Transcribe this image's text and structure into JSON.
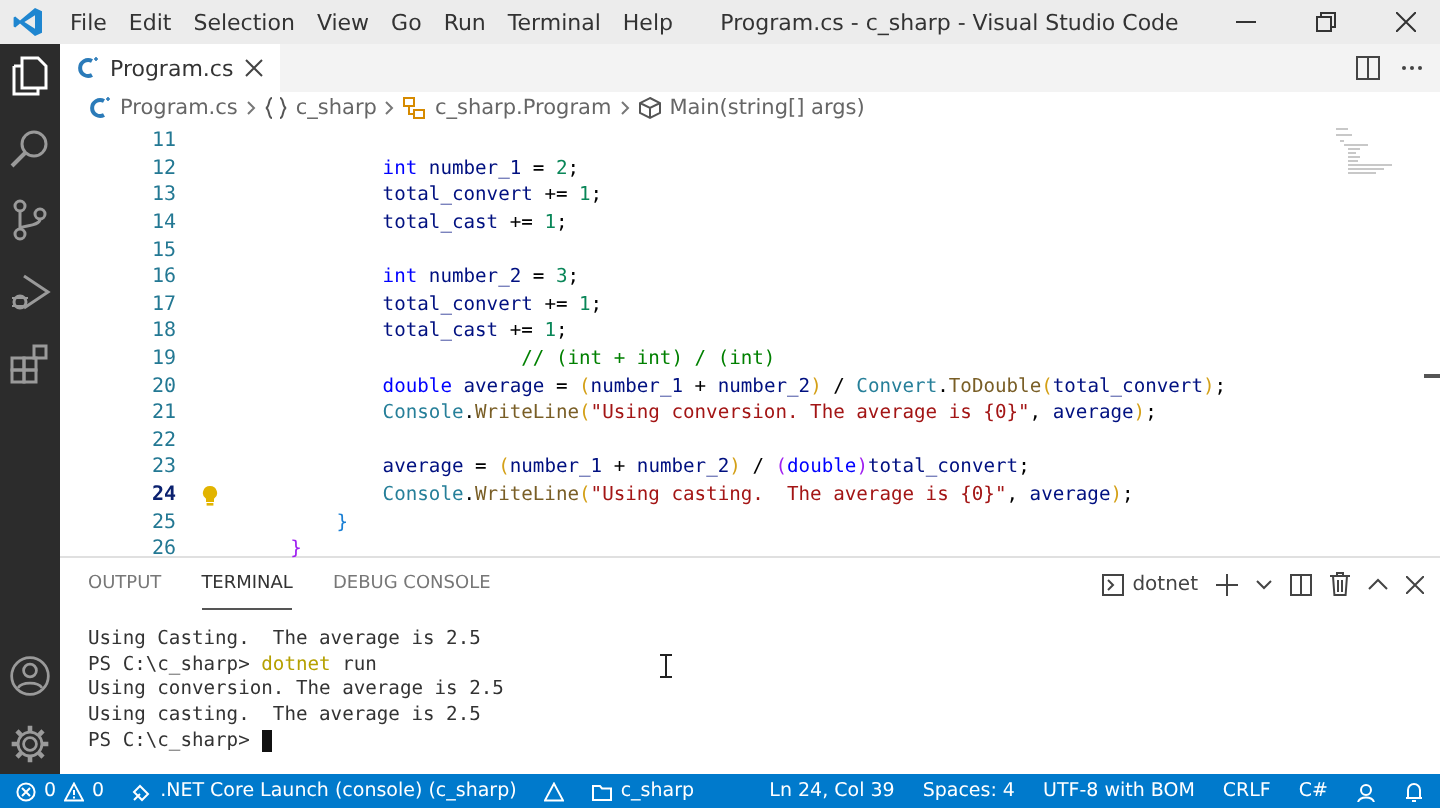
{
  "window": {
    "title": "Program.cs - c_sharp - Visual Studio Code"
  },
  "menu": [
    "File",
    "Edit",
    "Selection",
    "View",
    "Go",
    "Run",
    "Terminal",
    "Help"
  ],
  "activity_bar": [
    {
      "kind": "files",
      "selected": true
    },
    {
      "kind": "search",
      "selected": false
    },
    {
      "kind": "scm",
      "selected": false
    },
    {
      "kind": "debug",
      "selected": false
    },
    {
      "kind": "extensions",
      "selected": false
    }
  ],
  "editor_tabs": [
    {
      "label": "Program.cs",
      "selected": true
    }
  ],
  "breadcrumb": [
    {
      "kind": "file",
      "label": "Program.cs"
    },
    {
      "kind": "namespace",
      "label": "c_sharp"
    },
    {
      "kind": "class",
      "label": "c_sharp.Program"
    },
    {
      "kind": "method",
      "label": "Main(string[] args)"
    }
  ],
  "code": [
    {
      "number": "11",
      "current": false
    },
    {
      "number": "12",
      "current": false,
      "tokens": [
        {
          "kind": "keyword",
          "text": "            int"
        },
        {
          "kind": "variable",
          "text": " number_1 "
        },
        {
          "kind": "operator",
          "text": "= "
        },
        {
          "kind": "number",
          "text": "2"
        },
        {
          "kind": "operator",
          "text": ";"
        }
      ]
    },
    {
      "number": "13",
      "current": false,
      "tokens": [
        {
          "kind": "variable",
          "text": "            total_convert "
        },
        {
          "kind": "operator",
          "text": "+= "
        },
        {
          "kind": "number",
          "text": "1"
        },
        {
          "kind": "operator",
          "text": ";"
        }
      ]
    },
    {
      "number": "14",
      "current": false,
      "tokens": [
        {
          "kind": "variable",
          "text": "            total_cast "
        },
        {
          "kind": "operator",
          "text": "+= "
        },
        {
          "kind": "number",
          "text": "1"
        },
        {
          "kind": "operator",
          "text": ";"
        }
      ]
    },
    {
      "number": "15",
      "current": false
    },
    {
      "number": "16",
      "current": false,
      "tokens": [
        {
          "kind": "keyword",
          "text": "            int"
        },
        {
          "kind": "variable",
          "text": " number_2 "
        },
        {
          "kind": "operator",
          "text": "= "
        },
        {
          "kind": "number",
          "text": "3"
        },
        {
          "kind": "operator",
          "text": ";"
        }
      ]
    },
    {
      "number": "17",
      "current": false,
      "tokens": [
        {
          "kind": "variable",
          "text": "            total_convert "
        },
        {
          "kind": "operator",
          "text": "+= "
        },
        {
          "kind": "number",
          "text": "1"
        },
        {
          "kind": "operator",
          "text": ";"
        }
      ]
    },
    {
      "number": "18",
      "current": false,
      "tokens": [
        {
          "kind": "variable",
          "text": "            total_cast "
        },
        {
          "kind": "operator",
          "text": "+= "
        },
        {
          "kind": "number",
          "text": "1"
        },
        {
          "kind": "operator",
          "text": ";"
        }
      ]
    },
    {
      "number": "19",
      "current": false,
      "tokens": [
        {
          "kind": "comment",
          "text": "                        // (int + int) / (int)"
        }
      ]
    },
    {
      "number": "20",
      "current": false,
      "tokens": [
        {
          "kind": "keyword",
          "text": "            double"
        },
        {
          "kind": "variable",
          "text": " average "
        },
        {
          "kind": "operator",
          "text": "= "
        },
        {
          "kind": "bracket",
          "text": "("
        },
        {
          "kind": "variable",
          "text": "number_1 "
        },
        {
          "kind": "operator",
          "text": "+ "
        },
        {
          "kind": "variable",
          "text": "number_2"
        },
        {
          "kind": "bracket",
          "text": ")"
        },
        {
          "kind": "operator",
          "text": " / "
        },
        {
          "kind": "type",
          "text": "Convert"
        },
        {
          "kind": "operator",
          "text": "."
        },
        {
          "kind": "method",
          "text": "ToDouble"
        },
        {
          "kind": "bracket",
          "text": "("
        },
        {
          "kind": "variable",
          "text": "total_convert"
        },
        {
          "kind": "bracket",
          "text": ")"
        },
        {
          "kind": "operator",
          "text": ";"
        }
      ]
    },
    {
      "number": "21",
      "current": false,
      "tokens": [
        {
          "kind": "type",
          "text": "            Console"
        },
        {
          "kind": "operator",
          "text": "."
        },
        {
          "kind": "method",
          "text": "WriteLine"
        },
        {
          "kind": "bracket",
          "text": "("
        },
        {
          "kind": "string",
          "text": "\"Using conversion. The average is {0}\""
        },
        {
          "kind": "operator",
          "text": ", "
        },
        {
          "kind": "variable",
          "text": "average"
        },
        {
          "kind": "bracket",
          "text": ")"
        },
        {
          "kind": "operator",
          "text": ";"
        }
      ]
    },
    {
      "number": "22",
      "current": false
    },
    {
      "number": "23",
      "current": false,
      "tokens": [
        {
          "kind": "variable",
          "text": "            average "
        },
        {
          "kind": "operator",
          "text": "= "
        },
        {
          "kind": "bracket",
          "text": "("
        },
        {
          "kind": "variable",
          "text": "number_1 "
        },
        {
          "kind": "operator",
          "text": "+ "
        },
        {
          "kind": "variable",
          "text": "number_2"
        },
        {
          "kind": "bracket",
          "text": ")"
        },
        {
          "kind": "operator",
          "text": " / "
        },
        {
          "kind": "bracket2",
          "text": "("
        },
        {
          "kind": "keyword",
          "text": "double"
        },
        {
          "kind": "bracket2",
          "text": ")"
        },
        {
          "kind": "variable",
          "text": "total_convert"
        },
        {
          "kind": "operator",
          "text": ";"
        }
      ]
    },
    {
      "number": "24",
      "current": true,
      "tokens": [
        {
          "kind": "type",
          "text": "            Console"
        },
        {
          "kind": "operator",
          "text": "."
        },
        {
          "kind": "method",
          "text": "WriteLine"
        },
        {
          "kind": "bracket",
          "text": "("
        },
        {
          "kind": "string",
          "text": "\"Using casting.  The average is {0}\""
        },
        {
          "kind": "operator",
          "text": ", "
        },
        {
          "kind": "variable",
          "text": "average"
        },
        {
          "kind": "bracket",
          "text": ")"
        },
        {
          "kind": "operator",
          "text": ";"
        }
      ]
    },
    {
      "number": "25",
      "current": false,
      "tokens": [
        {
          "kind": "bracket3",
          "text": "        }"
        }
      ]
    },
    {
      "number": "26",
      "current": false,
      "tokens": [
        {
          "kind": "bracket2",
          "text": "    }"
        }
      ]
    }
  ],
  "panel_tabs": [
    {
      "label": "OUTPUT",
      "selected": false
    },
    {
      "label": "TERMINAL",
      "selected": true
    },
    {
      "label": "DEBUG CONSOLE",
      "selected": false
    }
  ],
  "terminal_selector": "dotnet",
  "terminal": [
    {
      "cursor": false,
      "tokens": [
        {
          "kind": "output",
          "text": "Using Casting.  The average is 2.5"
        }
      ]
    },
    {
      "cursor": false,
      "tokens": [
        {
          "kind": "output",
          "text": "PS C:\\c_sharp> "
        },
        {
          "kind": "command",
          "text": "dotnet"
        },
        {
          "kind": "output",
          "text": " run"
        }
      ]
    },
    {
      "cursor": false,
      "tokens": [
        {
          "kind": "output",
          "text": "Using conversion. The average is 2.5"
        }
      ]
    },
    {
      "cursor": false,
      "tokens": [
        {
          "kind": "output",
          "text": "Using casting.  The average is 2.5"
        }
      ]
    },
    {
      "cursor": true,
      "tokens": [
        {
          "kind": "output",
          "text": "PS C:\\c_sharp> "
        }
      ]
    }
  ],
  "status_bar": {
    "errors": "0",
    "warnings": "0",
    "launch": ".NET Core Launch (console) (c_sharp)",
    "folder": "c_sharp",
    "items": [
      "Ln 24, Col 39",
      "Spaces: 4",
      "UTF-8 with BOM",
      "CRLF",
      "C#"
    ]
  }
}
